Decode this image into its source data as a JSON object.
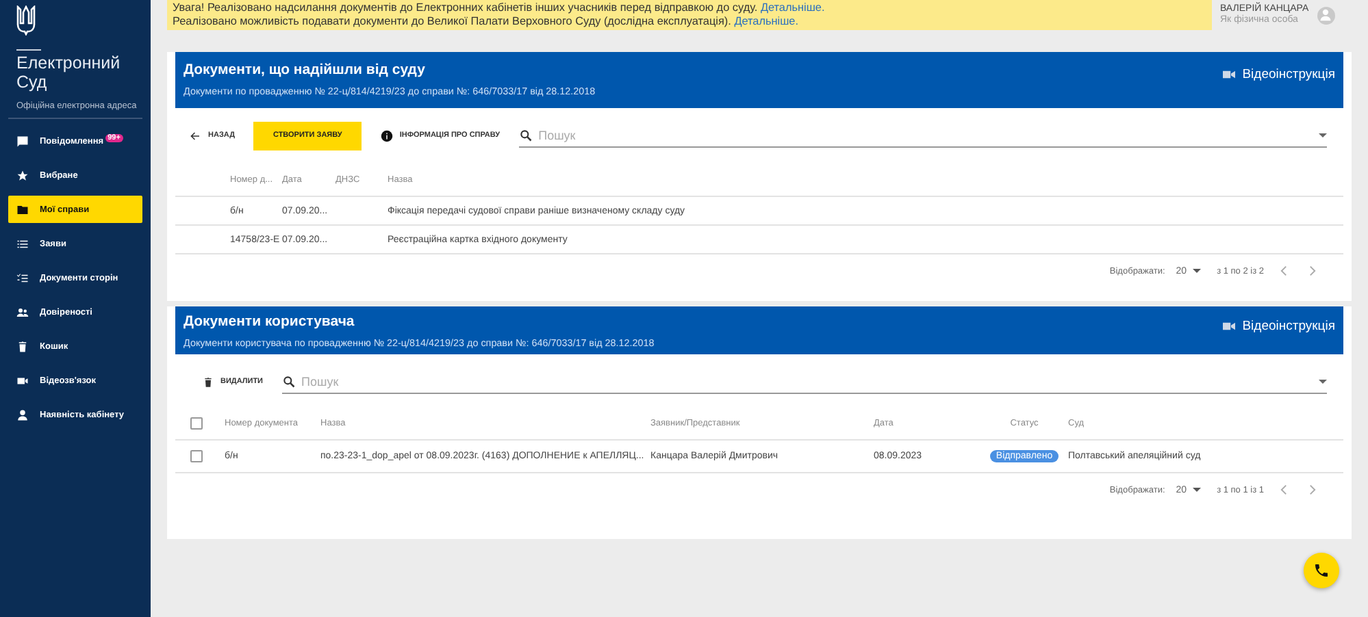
{
  "sidebar": {
    "title": "Електронний Суд",
    "subtitle": "Офіційна електронна адреса",
    "items": [
      {
        "label": "Повідомлення",
        "badge": "99+",
        "selected": false
      },
      {
        "label": "Вибране",
        "selected": false
      },
      {
        "label": "Мої справи",
        "selected": true
      },
      {
        "label": "Заяви",
        "selected": false
      },
      {
        "label": "Документи сторін",
        "selected": false
      },
      {
        "label": "Довіреності",
        "selected": false
      },
      {
        "label": "Кошик",
        "selected": false
      },
      {
        "label": "Відеозв'язок",
        "selected": false
      },
      {
        "label": "Наявність кабінету",
        "selected": false
      }
    ]
  },
  "notice": {
    "lines": [
      {
        "text": "Увага! Реалізовано надсилання документів до Електронних кабінетів інших учасників перед відправкою до суду.",
        "link": "Детальніше."
      },
      {
        "text": "Реалізовано можливість подавати документи до Великої Палати Верховного Суду (дослідна експлуатація).",
        "link": "Детальніше."
      }
    ]
  },
  "user": {
    "name": "ВАЛЕРІЙ КАНЦАРА",
    "role": "Як фізична особа"
  },
  "panels": [
    {
      "title": "Документи, що надійшли від суду",
      "subtitle": "Документи по провадженню № 22-ц/814/4219/23 до справи №: 646/7033/17 від 28.12.2018",
      "video_link": "Відеоінструкція",
      "toolbar": [
        {
          "kind": "back",
          "label": "НАЗАД"
        },
        {
          "kind": "primary",
          "label": "СТВОРИТИ ЗАЯВУ"
        },
        {
          "kind": "info",
          "label": "ІНФОРМАЦІЯ ПРО СПРАВУ"
        }
      ],
      "search": {
        "placeholder": "Пошук"
      },
      "table": {
        "kind": "court",
        "columns": [
          "Номер д...",
          "Дата",
          "ДНЗС",
          "Назва"
        ],
        "rows": [
          {
            "cells": [
              "б/н",
              "07.09.20...",
              "",
              "Фіксація передачі судової справи раніше визначеному складу суду"
            ]
          },
          {
            "cells": [
              "14758/23-Е",
              "07.09.20...",
              "",
              "Реєстраційна картка вхідного документу"
            ]
          }
        ]
      },
      "footer": {
        "per_page_label": "Відображати:",
        "per_page": "20",
        "range": "з 1 по 2 із 2"
      }
    },
    {
      "title": "Документи користувача",
      "subtitle": "Документи користувача по провадженню № 22-ц/814/4219/23 до справи №: 646/7033/17 від 28.12.2018",
      "video_link": "Відеоінструкція",
      "toolbar": [
        {
          "kind": "delete",
          "label": "ВИДАЛИТИ"
        }
      ],
      "search": {
        "placeholder": "Пошук"
      },
      "table": {
        "kind": "user",
        "header_checked": false,
        "columns": [
          "Номер документа",
          "Назва",
          "Заявник/Представник",
          "Дата",
          "Статус",
          "Суд"
        ],
        "rows": [
          {
            "checked": false,
            "cells": [
              "б/н",
              "по.23-23-1_dop_apel от 08.09.2023г. (4163) ДОПОЛНЕНИЕ к АПЕЛЛЯЦ...",
              "Канцара Валерій Дмитрович",
              "08.09.2023",
              "Відправлено",
              "Полтавський апеляційний суд"
            ]
          }
        ]
      },
      "footer": {
        "per_page_label": "Відображати:",
        "per_page": "20",
        "range": "з 1 по 1 із 1"
      }
    }
  ]
}
